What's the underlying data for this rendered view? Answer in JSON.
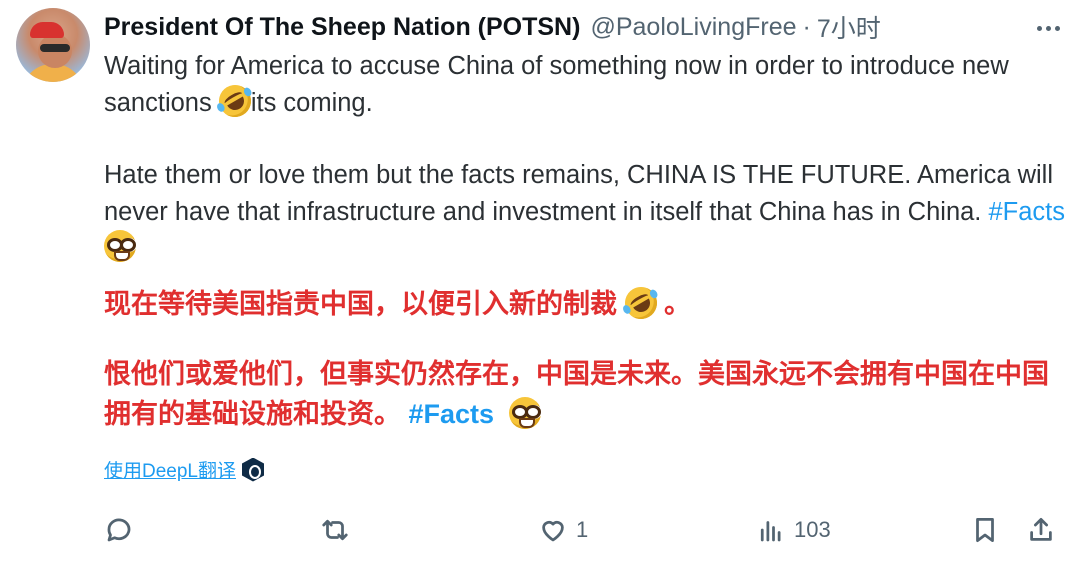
{
  "tweet": {
    "display_name": "President Of The Sheep Nation (POTSN)",
    "handle": "@PaoloLivingFree",
    "separator": "·",
    "time": "7小时",
    "text_line1": "Waiting for America to accuse China of something now in order to introduce new sanctions ",
    "text_line1_end": "its coming.",
    "text_para2": "Hate them or love them but the facts remains, CHINA IS THE FUTURE. America will never have that  infrastructure and investment in itself that China has in China. ",
    "hashtag": "#Facts"
  },
  "translation": {
    "line1_start": "现在等待美国指责中国，以便引入新的制裁 ",
    "line1_end": " 。",
    "para2": "恨他们或爱他们，但事实仍然存在，中国是未来。美国永远不会拥有中国在中国拥有的基础设施和投资。 ",
    "hashtag": "#Facts"
  },
  "deepl": {
    "label": "使用DeepL翻译"
  },
  "actions": {
    "reply_count": "",
    "retweet_count": "",
    "like_count": "1",
    "view_count": "103"
  },
  "icons": [
    "more-icon",
    "reply-icon",
    "retweet-icon",
    "like-icon",
    "views-icon",
    "bookmark-icon",
    "share-icon",
    "rofl-emoji-icon",
    "nerd-emoji-icon",
    "deepl-logo-icon"
  ],
  "colors": {
    "hashtag": "#1d9bf0",
    "translation_text": "#e02f2f",
    "secondary_text": "#536471"
  }
}
